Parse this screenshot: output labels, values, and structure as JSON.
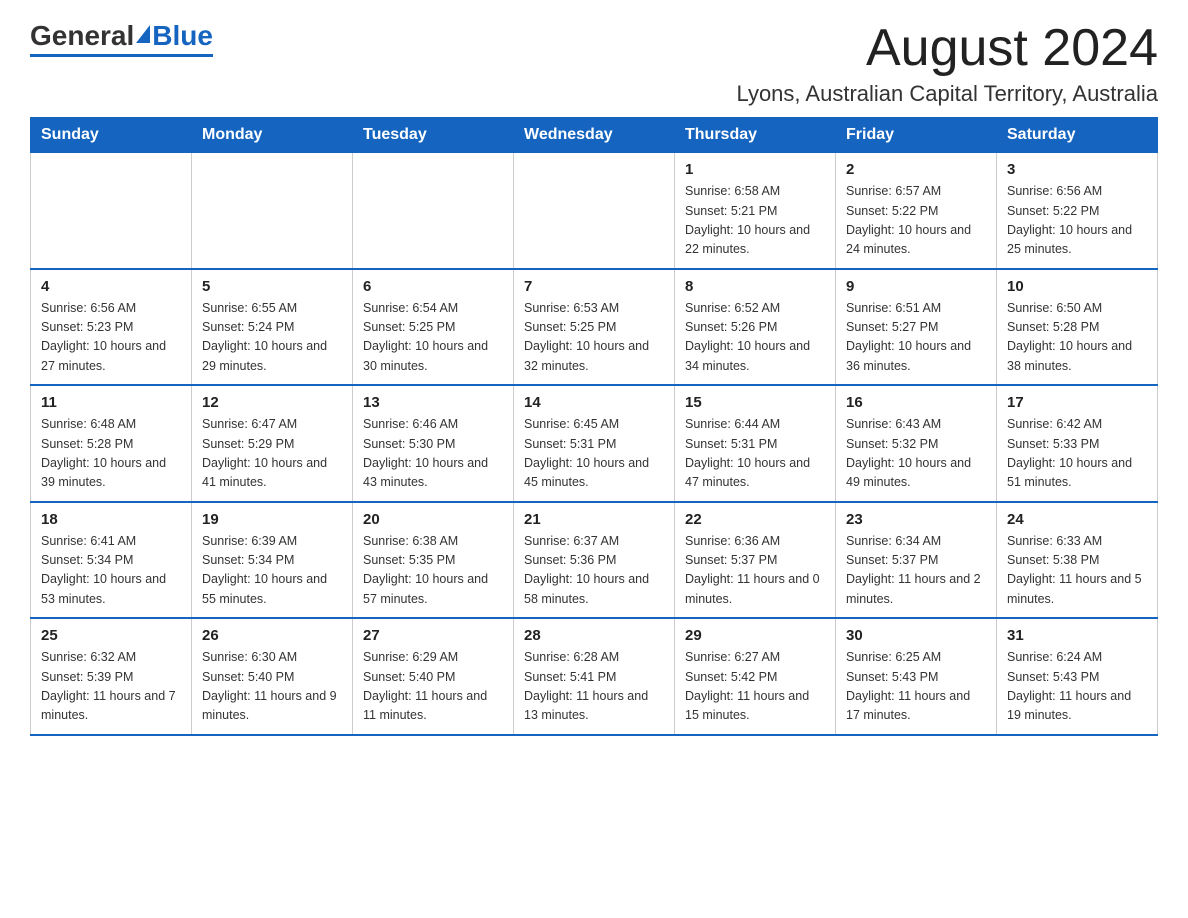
{
  "logo": {
    "general": "General",
    "blue": "Blue"
  },
  "header": {
    "month_title": "August 2024",
    "location": "Lyons, Australian Capital Territory, Australia"
  },
  "days_of_week": [
    "Sunday",
    "Monday",
    "Tuesday",
    "Wednesday",
    "Thursday",
    "Friday",
    "Saturday"
  ],
  "weeks": [
    [
      {
        "day": "",
        "info": ""
      },
      {
        "day": "",
        "info": ""
      },
      {
        "day": "",
        "info": ""
      },
      {
        "day": "",
        "info": ""
      },
      {
        "day": "1",
        "info": "Sunrise: 6:58 AM\nSunset: 5:21 PM\nDaylight: 10 hours and 22 minutes."
      },
      {
        "day": "2",
        "info": "Sunrise: 6:57 AM\nSunset: 5:22 PM\nDaylight: 10 hours and 24 minutes."
      },
      {
        "day": "3",
        "info": "Sunrise: 6:56 AM\nSunset: 5:22 PM\nDaylight: 10 hours and 25 minutes."
      }
    ],
    [
      {
        "day": "4",
        "info": "Sunrise: 6:56 AM\nSunset: 5:23 PM\nDaylight: 10 hours and 27 minutes."
      },
      {
        "day": "5",
        "info": "Sunrise: 6:55 AM\nSunset: 5:24 PM\nDaylight: 10 hours and 29 minutes."
      },
      {
        "day": "6",
        "info": "Sunrise: 6:54 AM\nSunset: 5:25 PM\nDaylight: 10 hours and 30 minutes."
      },
      {
        "day": "7",
        "info": "Sunrise: 6:53 AM\nSunset: 5:25 PM\nDaylight: 10 hours and 32 minutes."
      },
      {
        "day": "8",
        "info": "Sunrise: 6:52 AM\nSunset: 5:26 PM\nDaylight: 10 hours and 34 minutes."
      },
      {
        "day": "9",
        "info": "Sunrise: 6:51 AM\nSunset: 5:27 PM\nDaylight: 10 hours and 36 minutes."
      },
      {
        "day": "10",
        "info": "Sunrise: 6:50 AM\nSunset: 5:28 PM\nDaylight: 10 hours and 38 minutes."
      }
    ],
    [
      {
        "day": "11",
        "info": "Sunrise: 6:48 AM\nSunset: 5:28 PM\nDaylight: 10 hours and 39 minutes."
      },
      {
        "day": "12",
        "info": "Sunrise: 6:47 AM\nSunset: 5:29 PM\nDaylight: 10 hours and 41 minutes."
      },
      {
        "day": "13",
        "info": "Sunrise: 6:46 AM\nSunset: 5:30 PM\nDaylight: 10 hours and 43 minutes."
      },
      {
        "day": "14",
        "info": "Sunrise: 6:45 AM\nSunset: 5:31 PM\nDaylight: 10 hours and 45 minutes."
      },
      {
        "day": "15",
        "info": "Sunrise: 6:44 AM\nSunset: 5:31 PM\nDaylight: 10 hours and 47 minutes."
      },
      {
        "day": "16",
        "info": "Sunrise: 6:43 AM\nSunset: 5:32 PM\nDaylight: 10 hours and 49 minutes."
      },
      {
        "day": "17",
        "info": "Sunrise: 6:42 AM\nSunset: 5:33 PM\nDaylight: 10 hours and 51 minutes."
      }
    ],
    [
      {
        "day": "18",
        "info": "Sunrise: 6:41 AM\nSunset: 5:34 PM\nDaylight: 10 hours and 53 minutes."
      },
      {
        "day": "19",
        "info": "Sunrise: 6:39 AM\nSunset: 5:34 PM\nDaylight: 10 hours and 55 minutes."
      },
      {
        "day": "20",
        "info": "Sunrise: 6:38 AM\nSunset: 5:35 PM\nDaylight: 10 hours and 57 minutes."
      },
      {
        "day": "21",
        "info": "Sunrise: 6:37 AM\nSunset: 5:36 PM\nDaylight: 10 hours and 58 minutes."
      },
      {
        "day": "22",
        "info": "Sunrise: 6:36 AM\nSunset: 5:37 PM\nDaylight: 11 hours and 0 minutes."
      },
      {
        "day": "23",
        "info": "Sunrise: 6:34 AM\nSunset: 5:37 PM\nDaylight: 11 hours and 2 minutes."
      },
      {
        "day": "24",
        "info": "Sunrise: 6:33 AM\nSunset: 5:38 PM\nDaylight: 11 hours and 5 minutes."
      }
    ],
    [
      {
        "day": "25",
        "info": "Sunrise: 6:32 AM\nSunset: 5:39 PM\nDaylight: 11 hours and 7 minutes."
      },
      {
        "day": "26",
        "info": "Sunrise: 6:30 AM\nSunset: 5:40 PM\nDaylight: 11 hours and 9 minutes."
      },
      {
        "day": "27",
        "info": "Sunrise: 6:29 AM\nSunset: 5:40 PM\nDaylight: 11 hours and 11 minutes."
      },
      {
        "day": "28",
        "info": "Sunrise: 6:28 AM\nSunset: 5:41 PM\nDaylight: 11 hours and 13 minutes."
      },
      {
        "day": "29",
        "info": "Sunrise: 6:27 AM\nSunset: 5:42 PM\nDaylight: 11 hours and 15 minutes."
      },
      {
        "day": "30",
        "info": "Sunrise: 6:25 AM\nSunset: 5:43 PM\nDaylight: 11 hours and 17 minutes."
      },
      {
        "day": "31",
        "info": "Sunrise: 6:24 AM\nSunset: 5:43 PM\nDaylight: 11 hours and 19 minutes."
      }
    ]
  ]
}
